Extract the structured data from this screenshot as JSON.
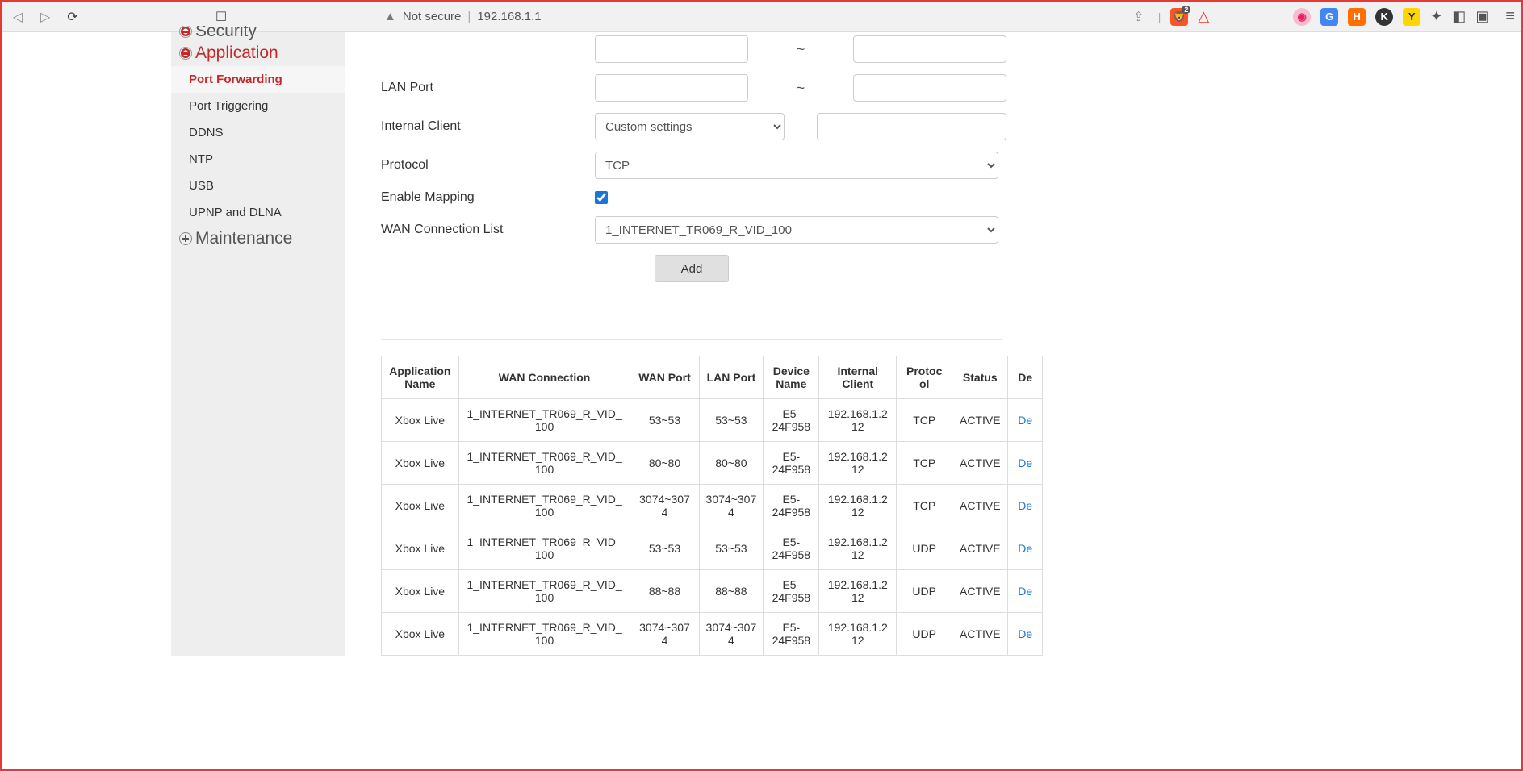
{
  "browser": {
    "not_secure": "Not secure",
    "url": "192.168.1.1",
    "brave_count": "2"
  },
  "sidebar": {
    "security": "Security",
    "application": "Application",
    "maintenance": "Maintenance",
    "items": [
      "Port Forwarding",
      "Port Triggering",
      "DDNS",
      "NTP",
      "USB",
      "UPNP and DLNA"
    ]
  },
  "form": {
    "lan_port": "LAN Port",
    "internal_client": "Internal Client",
    "internal_client_value": "Custom settings",
    "protocol": "Protocol",
    "protocol_value": "TCP",
    "enable_mapping": "Enable Mapping",
    "wan_list": "WAN Connection List",
    "wan_list_value": "1_INTERNET_TR069_R_VID_100",
    "add": "Add",
    "tilde": "~"
  },
  "table": {
    "headers": [
      "Application Name",
      "WAN Connection",
      "WAN Port",
      "LAN Port",
      "Device Name",
      "Internal Client",
      "Protocol",
      "Status",
      "De"
    ],
    "rows": [
      {
        "app": "Xbox Live",
        "wan": "1_INTERNET_TR069_R_VID_100",
        "wp": "53~53",
        "lp": "53~53",
        "dev": "E5-24F958",
        "ic": "192.168.1.212",
        "pro": "TCP",
        "st": "ACTIVE",
        "del": "De"
      },
      {
        "app": "Xbox Live",
        "wan": "1_INTERNET_TR069_R_VID_100",
        "wp": "80~80",
        "lp": "80~80",
        "dev": "E5-24F958",
        "ic": "192.168.1.212",
        "pro": "TCP",
        "st": "ACTIVE",
        "del": "De"
      },
      {
        "app": "Xbox Live",
        "wan": "1_INTERNET_TR069_R_VID_100",
        "wp": "3074~3074",
        "lp": "3074~3074",
        "dev": "E5-24F958",
        "ic": "192.168.1.212",
        "pro": "TCP",
        "st": "ACTIVE",
        "del": "De"
      },
      {
        "app": "Xbox Live",
        "wan": "1_INTERNET_TR069_R_VID_100",
        "wp": "53~53",
        "lp": "53~53",
        "dev": "E5-24F958",
        "ic": "192.168.1.212",
        "pro": "UDP",
        "st": "ACTIVE",
        "del": "De"
      },
      {
        "app": "Xbox Live",
        "wan": "1_INTERNET_TR069_R_VID_100",
        "wp": "88~88",
        "lp": "88~88",
        "dev": "E5-24F958",
        "ic": "192.168.1.212",
        "pro": "UDP",
        "st": "ACTIVE",
        "del": "De"
      },
      {
        "app": "Xbox Live",
        "wan": "1_INTERNET_TR069_R_VID_100",
        "wp": "3074~3074",
        "lp": "3074~3074",
        "dev": "E5-24F958",
        "ic": "192.168.1.212",
        "pro": "UDP",
        "st": "ACTIVE",
        "del": "De"
      }
    ]
  }
}
